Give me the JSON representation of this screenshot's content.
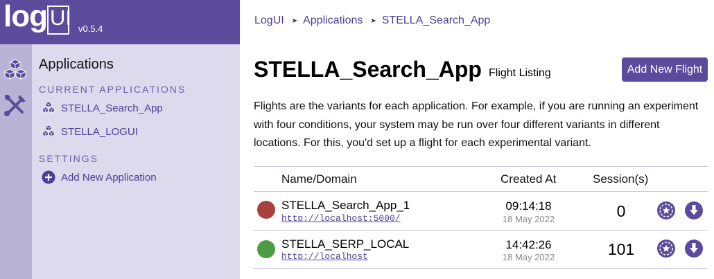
{
  "app": {
    "logo_main": "log",
    "logo_boxed": "UI",
    "version": "v0.5.4"
  },
  "sidebar": {
    "title": "Applications",
    "sections": [
      {
        "heading": "CURRENT APPLICATIONS",
        "items": [
          {
            "label": "STELLA_Search_App",
            "icon": "cubes-icon"
          },
          {
            "label": "STELLA_LOGUI",
            "icon": "cubes-icon"
          }
        ]
      },
      {
        "heading": "SETTINGS",
        "items": [
          {
            "label": "Add New Application",
            "icon": "plus-circle-icon"
          }
        ]
      }
    ],
    "iconbar": [
      "cubes-icon",
      "tools-icon"
    ]
  },
  "breadcrumb": [
    "LogUI",
    "Applications",
    "STELLA_Search_App"
  ],
  "header": {
    "title": "STELLA_Search_App",
    "subtitle": "Flight Listing",
    "add_button": "Add New Flight"
  },
  "description": "Flights are the variants for each application. For example, if you are running an experiment with four conditions, your system may be run over four different variants in different locations. For this, you'd set up a flight for each experimental variant.",
  "table": {
    "columns": [
      "Name/Domain",
      "Created At",
      "Session(s)"
    ],
    "rows": [
      {
        "name": "STELLA_Search_App_1",
        "url": "http://localhost:5000/",
        "time": "09:14:18",
        "date": "18 May 2022",
        "sessions": "0",
        "status": "inactive",
        "status_color": "#a8413d"
      },
      {
        "name": "STELLA_SERP_LOCAL",
        "url": "http://localhost",
        "time": "14:42:26",
        "date": "18 May 2022",
        "sessions": "101",
        "status": "active",
        "status_color": "#4c9c45"
      }
    ]
  },
  "colors": {
    "accent": "#5a4b9c",
    "sidebar_bg": "#dcdaec",
    "iconbar_bg": "#b9b4d6",
    "link": "#4b3e96"
  }
}
